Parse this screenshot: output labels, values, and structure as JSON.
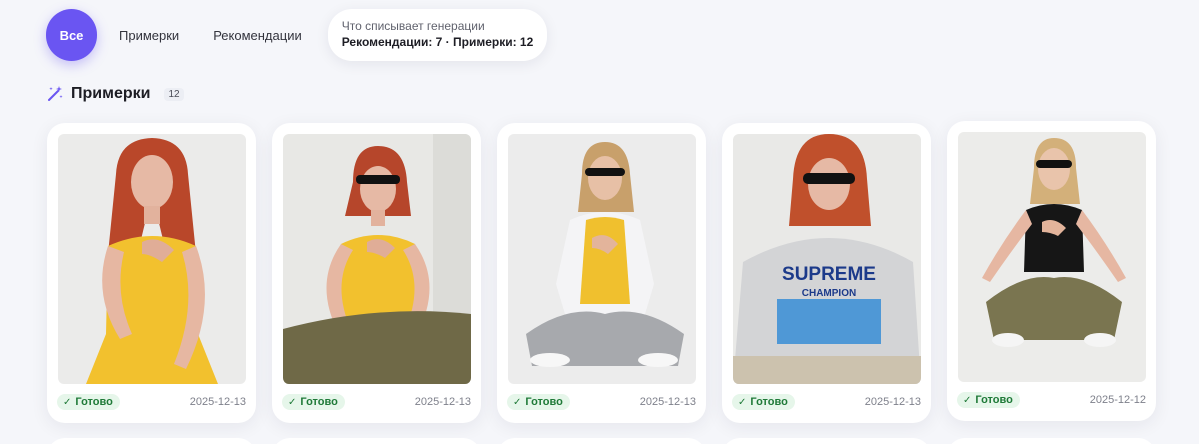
{
  "filters": {
    "all_label": "Все",
    "tryons_label": "Примерки",
    "recs_label": "Рекомендации",
    "info_line1": "Что списывает генерации",
    "info_line2": "Рекомендации: 7 · Примерки: 12"
  },
  "section": {
    "title": "Примерки",
    "count": "12",
    "icon": "magic-wand-icon"
  },
  "colors": {
    "accent": "#6a55f2",
    "status_bg": "#e6f6ea",
    "status_text": "#1f7a38"
  },
  "cards": [
    {
      "status": "Готово",
      "date": "2025-12-13"
    },
    {
      "status": "Готово",
      "date": "2025-12-13"
    },
    {
      "status": "Готово",
      "date": "2025-12-13"
    },
    {
      "status": "Готово",
      "date": "2025-12-13"
    },
    {
      "status": "Готово",
      "date": "2025-12-12"
    }
  ],
  "card3_print": {
    "brand": "SUPREME",
    "sub": "CHAMPION"
  }
}
